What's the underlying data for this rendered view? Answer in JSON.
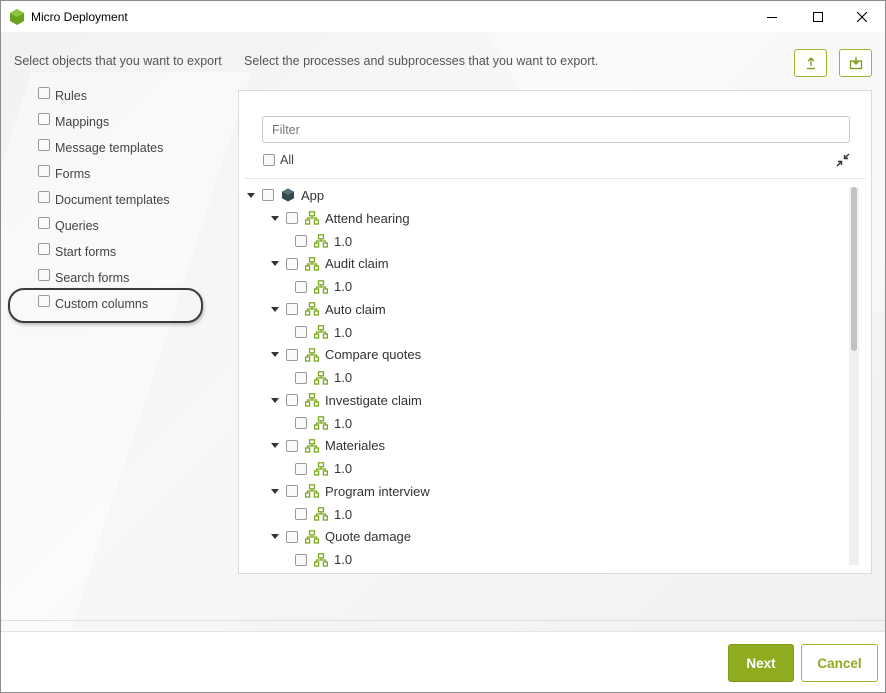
{
  "window": {
    "title": "Micro Deployment",
    "controls": [
      "minimize",
      "maximize",
      "close"
    ]
  },
  "left_panel": {
    "title": "Select objects that you want to export",
    "items": [
      {
        "label": "Rules",
        "checked": false
      },
      {
        "label": "Mappings",
        "checked": false
      },
      {
        "label": "Message templates",
        "checked": false
      },
      {
        "label": "Forms",
        "checked": false
      },
      {
        "label": "Document templates",
        "checked": false
      },
      {
        "label": "Queries",
        "checked": false
      },
      {
        "label": "Start forms",
        "checked": false
      },
      {
        "label": "Search forms",
        "checked": false
      },
      {
        "label": "Custom columns",
        "checked": false,
        "highlighted": true
      }
    ]
  },
  "right_panel": {
    "title": "Select the processes and subprocesses that you want to export.",
    "filter_placeholder": "Filter",
    "all_label": "All",
    "tree": {
      "root": {
        "label": "App",
        "expanded": true
      },
      "processes": [
        {
          "label": "Attend hearing",
          "version": "1.0"
        },
        {
          "label": "Audit claim",
          "version": "1.0"
        },
        {
          "label": "Auto claim",
          "version": "1.0"
        },
        {
          "label": "Compare quotes",
          "version": "1.0"
        },
        {
          "label": "Investigate claim",
          "version": "1.0"
        },
        {
          "label": "Materiales",
          "version": "1.0"
        },
        {
          "label": "Program interview",
          "version": "1.0"
        },
        {
          "label": "Quote damage",
          "version": "1.0"
        }
      ]
    }
  },
  "footer": {
    "next_label": "Next",
    "cancel_label": "Cancel"
  },
  "colors": {
    "accent": "#8fac20",
    "accent_border": "#9bb733",
    "node_icon": "#7aa81e",
    "root_icon": "#37474f"
  }
}
